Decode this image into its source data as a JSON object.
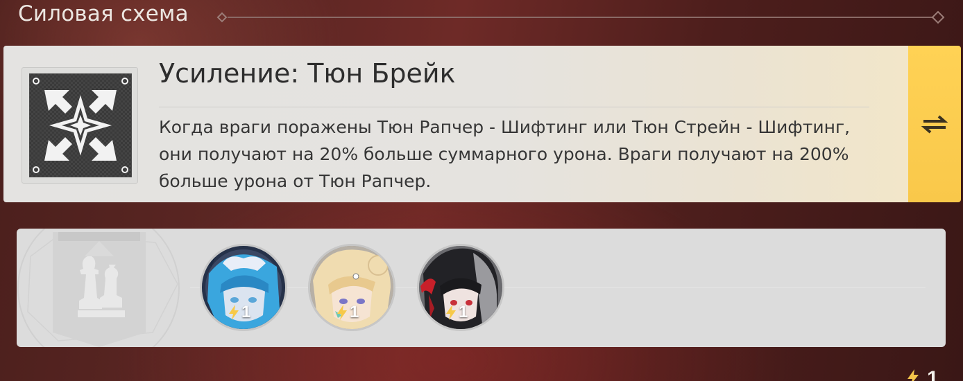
{
  "section": {
    "title": "Силовая схема"
  },
  "buff": {
    "icon": "chaos-star-icon",
    "title": "Усиление: Тюн Брейк",
    "description": "Когда враги поражены Тюн Рапчер - Шифтинг или Тюн Стрейн - Шифтинг, они получают на 20% больше суммарного урона. Враги получают на 200% больше урона от Тюн Рапчер.",
    "swap_icon": "swap-arrows-icon"
  },
  "team": {
    "emblem_icon": "chess-pieces-icon",
    "agents": [
      {
        "name": "blue-haired-agent",
        "level_icon": "energy-bolt-icon",
        "level": "1",
        "colors": {
          "hair": "#3aa6de",
          "bg": "#26324a"
        }
      },
      {
        "name": "blonde-haired-agent",
        "level_icon": "energy-bolt-icon",
        "level": "1",
        "colors": {
          "hair": "#f0dcb0",
          "bg": "#b7b0a6"
        }
      },
      {
        "name": "black-haired-agent",
        "level_icon": "energy-bolt-icon",
        "level": "1",
        "colors": {
          "hair": "#222226",
          "bg": "#6b6b6f"
        }
      }
    ]
  },
  "footer": {
    "count": "1"
  },
  "colors": {
    "accent": "#ffd255",
    "card_bg": "#e4e3e1",
    "panel_bg": "#dcdcdc",
    "background": "#5b2623"
  }
}
